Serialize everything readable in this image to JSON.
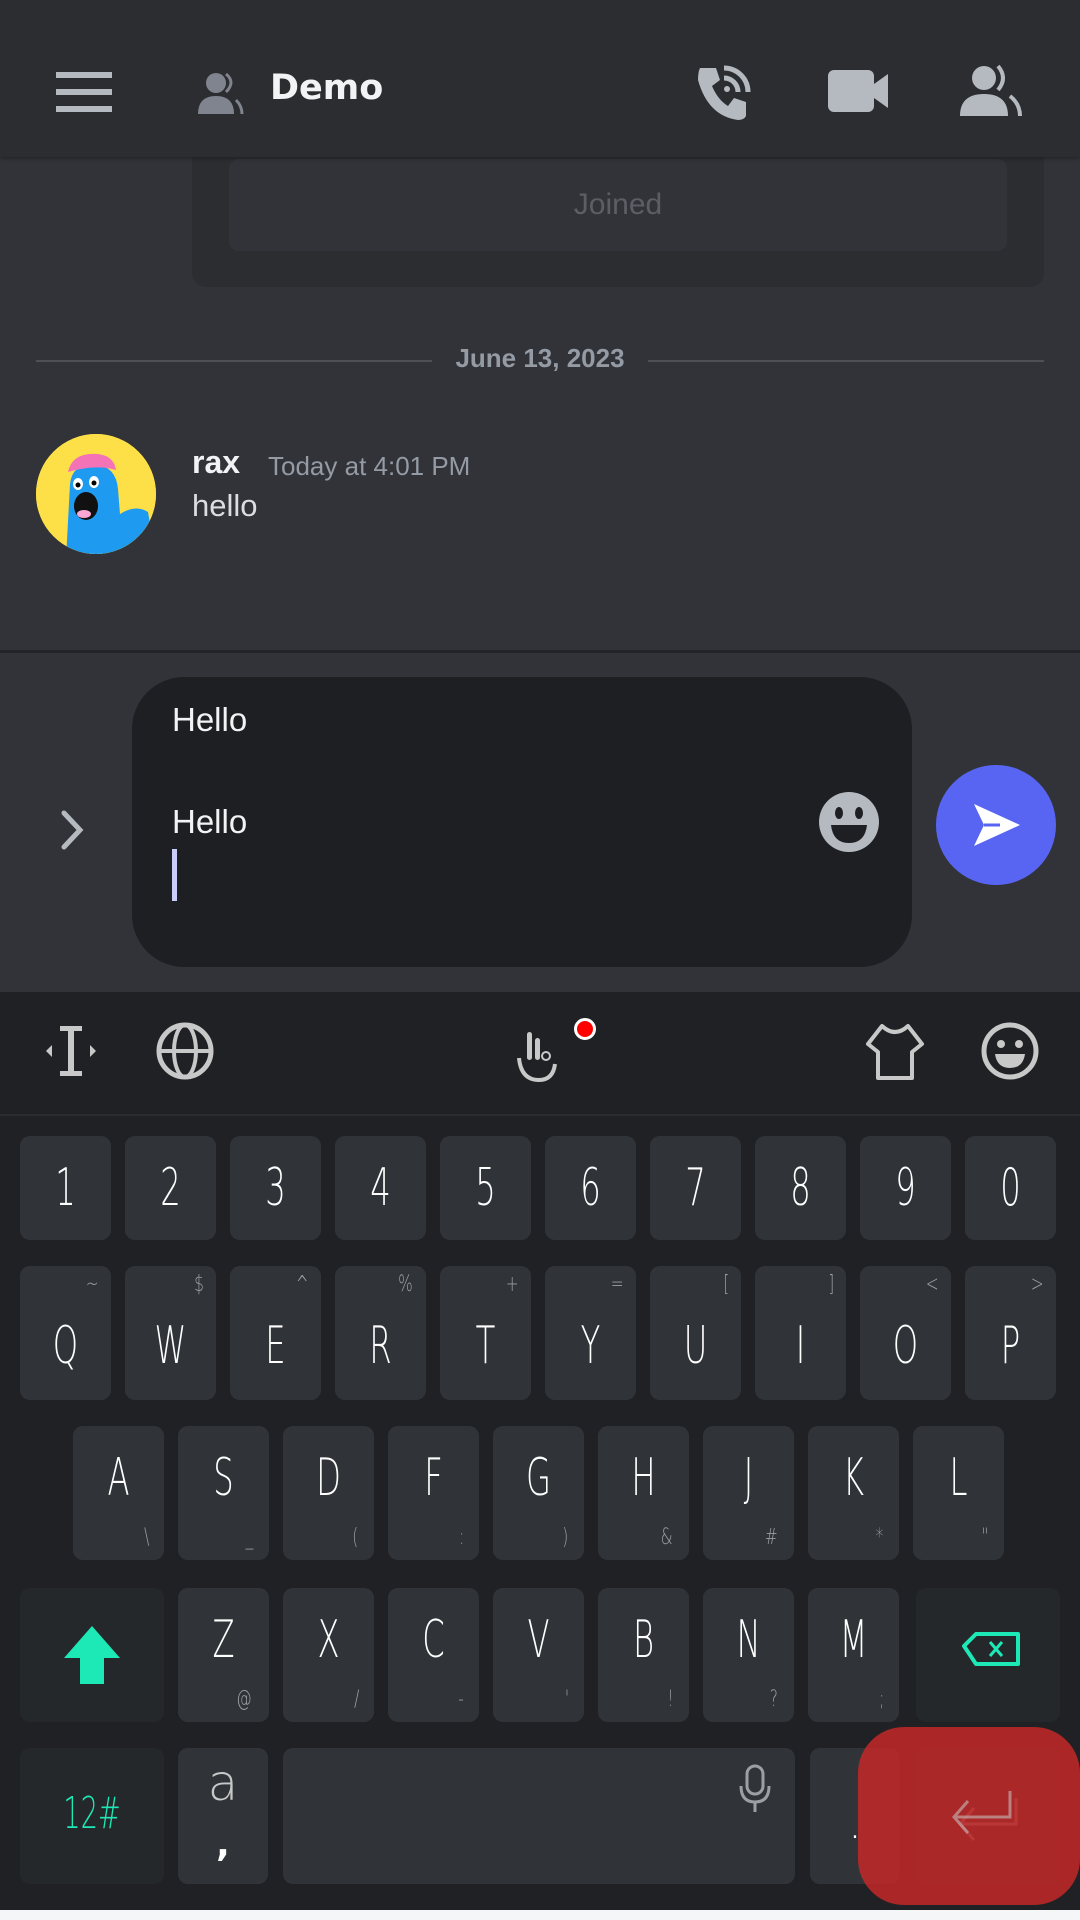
{
  "header": {
    "channel_title": "Demo",
    "icons": [
      "menu-icon",
      "group-dm-icon",
      "voice-call-icon",
      "video-call-icon",
      "members-icon"
    ]
  },
  "chat": {
    "joined_button_label": "Joined",
    "date_divider": "June 13, 2023",
    "messages": [
      {
        "username": "rax",
        "timestamp": "Today at 4:01 PM",
        "text": "hello"
      }
    ]
  },
  "composer": {
    "lines": [
      "Hello",
      "",
      "Hello",
      ""
    ],
    "line1": "Hello",
    "line2": "Hello",
    "send_color": "#5865f2"
  },
  "keyboard": {
    "toolbar_icons": [
      "cursor-move-icon",
      "globe-icon",
      "gesture-icon",
      "theme-shirt-icon",
      "emoji-icon"
    ],
    "notification_dot_color": "#ff0000",
    "number_row": [
      "1",
      "2",
      "3",
      "4",
      "5",
      "6",
      "7",
      "8",
      "9",
      "0"
    ],
    "row1": [
      {
        "k": "Q",
        "s": "~"
      },
      {
        "k": "W",
        "s": "$"
      },
      {
        "k": "E",
        "s": "^"
      },
      {
        "k": "R",
        "s": "%"
      },
      {
        "k": "T",
        "s": "+"
      },
      {
        "k": "Y",
        "s": "="
      },
      {
        "k": "U",
        "s": "["
      },
      {
        "k": "I",
        "s": "]"
      },
      {
        "k": "O",
        "s": "<"
      },
      {
        "k": "P",
        "s": ">"
      }
    ],
    "row2": [
      {
        "k": "A",
        "s": "\\"
      },
      {
        "k": "S",
        "s": "_"
      },
      {
        "k": "D",
        "s": "("
      },
      {
        "k": "F",
        "s": ":"
      },
      {
        "k": "G",
        "s": ")"
      },
      {
        "k": "H",
        "s": "&"
      },
      {
        "k": "J",
        "s": "#"
      },
      {
        "k": "K",
        "s": "*"
      },
      {
        "k": "L",
        "s": "\""
      }
    ],
    "row3": [
      {
        "k": "Z",
        "s": "@"
      },
      {
        "k": "X",
        "s": "/"
      },
      {
        "k": "C",
        "s": "-"
      },
      {
        "k": "V",
        "s": "'"
      },
      {
        "k": "B",
        "s": "!"
      },
      {
        "k": "N",
        "s": "?"
      },
      {
        "k": "M",
        "s": ";"
      }
    ],
    "symbols_key": "12#",
    "comma_key": {
      "k": "a",
      "s": ","
    },
    "period_key": ".",
    "accent_color": "#1de9b6"
  }
}
